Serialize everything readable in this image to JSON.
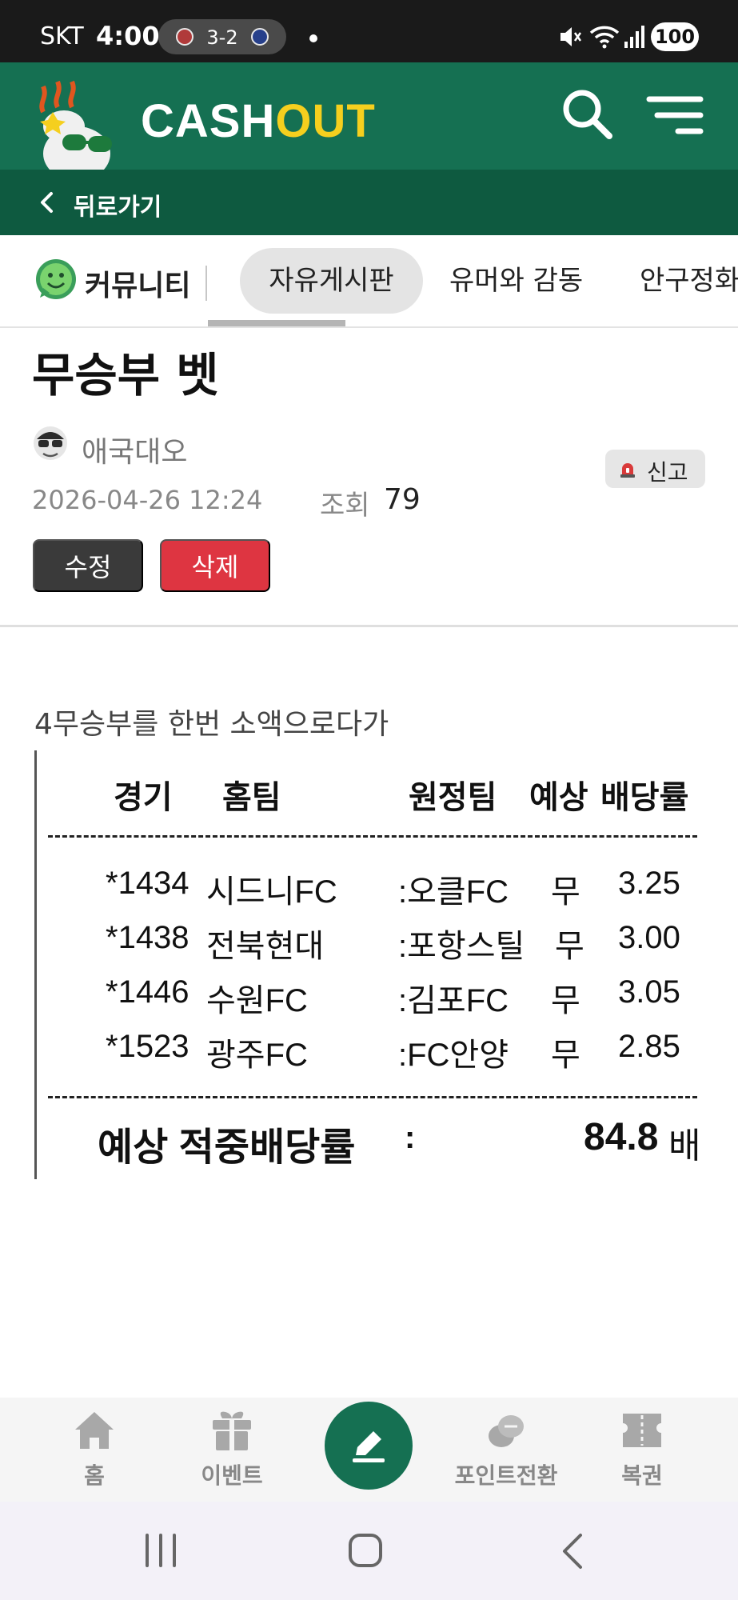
{
  "status_bar": {
    "carrier": "SKT",
    "time": "4:00",
    "game_score": "3-2",
    "battery": "100"
  },
  "header": {
    "logo_text_main": "CASH",
    "logo_text_accent": "OUT",
    "back_label": "뒤로가기"
  },
  "tabs": {
    "section_label": "커뮤니티",
    "items": [
      "자유게시판",
      "유머와 감동",
      "안구정화"
    ],
    "active_index": 0
  },
  "post": {
    "title": "무승부 벳",
    "author": "애국대오",
    "report_label": "신고",
    "date": "2026-04-26 12:24",
    "views_label": "조회",
    "views": "79",
    "edit_label": "수정",
    "delete_label": "삭제",
    "body_text": "4무승부를 한번 소액으로다가"
  },
  "bet_slip": {
    "headers": {
      "game": "경기",
      "home": "홈팀",
      "away": "원정팀",
      "prediction": "예상",
      "odds": "배당률"
    },
    "rows": [
      {
        "game": "*1434",
        "home": "시드니FC",
        "away": ":오클FC",
        "pick": "무",
        "odds": "3.25"
      },
      {
        "game": "*1438",
        "home": "전북현대",
        "away": ":포항스틸",
        "pick": "무",
        "odds": "3.00"
      },
      {
        "game": "*1446",
        "home": "수원FC",
        "away": ":김포FC",
        "pick": "무",
        "odds": "3.05"
      },
      {
        "game": "*1523",
        "home": "광주FC",
        "away": ":FC안양",
        "pick": "무",
        "odds": "2.85"
      }
    ],
    "total_label": "예상 적중배당률",
    "total_colon": ":",
    "total_value": "84.8",
    "total_unit": "배"
  },
  "bottom_nav": {
    "items": [
      {
        "label": "홈",
        "icon": "home-icon"
      },
      {
        "label": "이벤트",
        "icon": "gift-icon"
      },
      {
        "label": "",
        "icon": "pencil-icon"
      },
      {
        "label": "포인트전환",
        "icon": "coins-icon"
      },
      {
        "label": "복권",
        "icon": "ticket-icon"
      }
    ]
  },
  "colors": {
    "brand_green": "#157052",
    "brand_dark_green": "#0e5a40",
    "logo_accent": "#f5cf1e",
    "delete_red": "#de3541",
    "edit_dark": "#3a3a3a"
  }
}
